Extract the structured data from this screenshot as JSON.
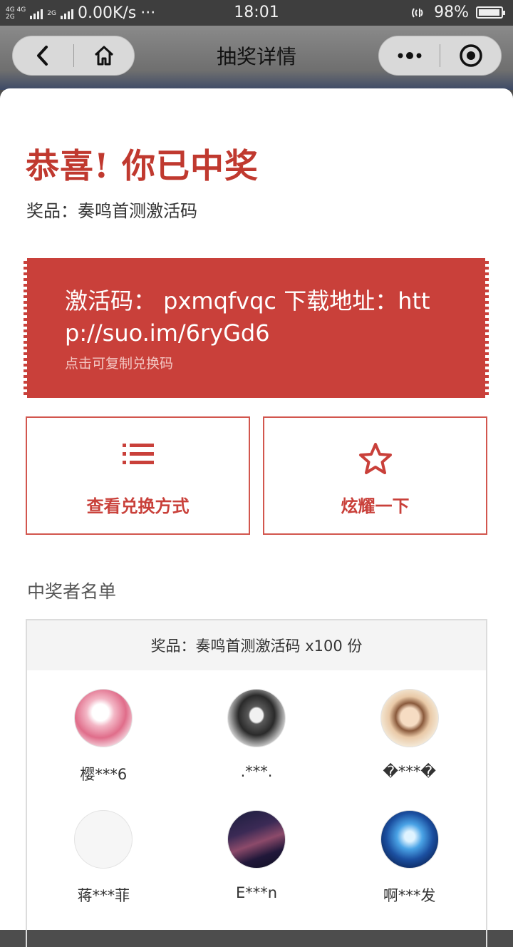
{
  "status_bar": {
    "network_top": "4G 4G",
    "network_bottom": "2G",
    "network_extra": "2G",
    "speed": "0.00K/s",
    "more": "···",
    "time": "18:01",
    "battery": "98%",
    "battery_level": 0.98
  },
  "nav": {
    "title": "抽奖详情"
  },
  "result": {
    "title": "恭喜! 你已中奖",
    "prize": "奖品：奏鸣首测激活码"
  },
  "ticket": {
    "code": "激活码： pxmqfvqc 下载地址：http://suo.im/6ryGd6",
    "hint": "点击可复制兑换码",
    "color": "#c9403a"
  },
  "actions": {
    "redeem_label": "查看兑换方式",
    "redeem_icon": "list-icon",
    "share_label": "炫耀一下",
    "share_icon": "star-icon"
  },
  "winners": {
    "heading": "中奖者名单",
    "prize_header": "奖品：奏鸣首测激活码 x100 份",
    "list": [
      {
        "name": "樱***6",
        "avatar": "pink-anime-avatar"
      },
      {
        "name": ".***.",
        "avatar": "bw-anime-avatar"
      },
      {
        "name": "�***�",
        "avatar": "child-photo-avatar"
      },
      {
        "name": "蒋***菲",
        "avatar": "blank-avatar"
      },
      {
        "name": "E***n",
        "avatar": "night-scene-avatar"
      },
      {
        "name": "啊***发",
        "avatar": "blue-space-avatar"
      }
    ]
  }
}
